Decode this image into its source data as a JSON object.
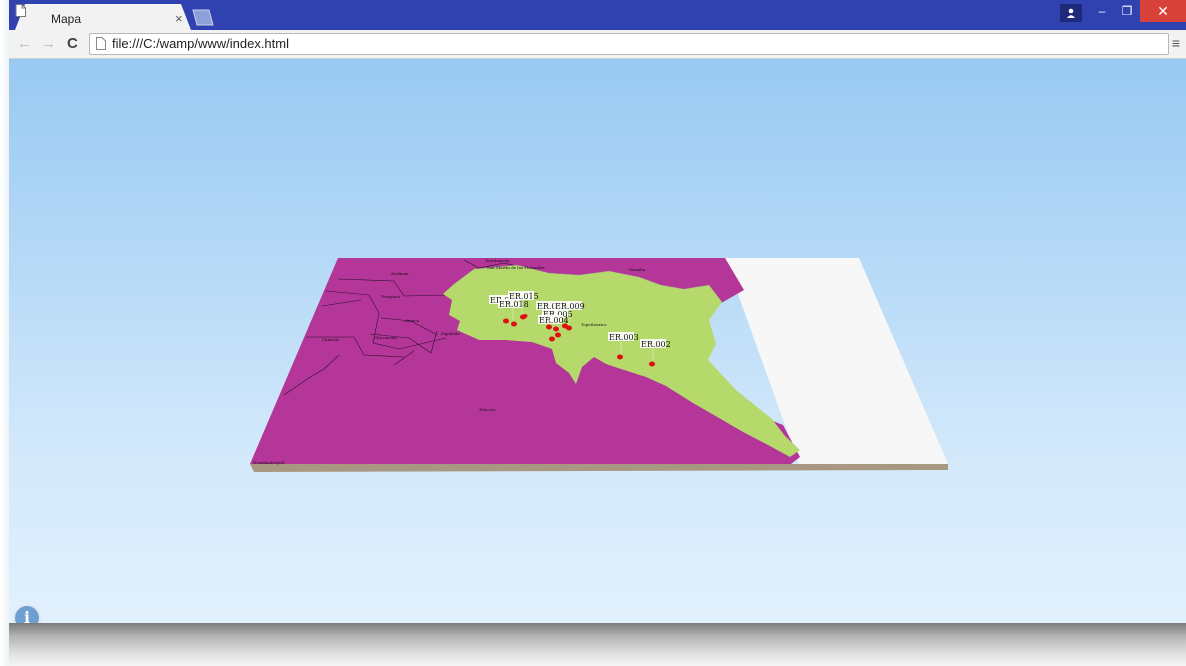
{
  "browser": {
    "tab_title": "Mapa",
    "tab_close": "×",
    "url": "file:///C:/wamp/www/index.html",
    "back_icon": "arrow-left-icon",
    "forward_icon": "arrow-right-icon",
    "reload_icon": "reload-icon",
    "menu_icon": "hamburger-menu-icon",
    "accent_color": "#3042b0",
    "close_color": "#d9423a"
  },
  "window_controls": {
    "user": "user-icon",
    "minimize": "–",
    "maximize": "❐",
    "close": "✕"
  },
  "map": {
    "region_colors": {
      "municipalities": "#b43699",
      "highlight": "#b6d96b",
      "outside": "#f7f7f7",
      "base_edge": "#a89882"
    },
    "place_labels": {
      "top_left": "Acolman",
      "top_center": "San Martín de las Pirámides",
      "top_right": "Otumba",
      "left_1": "Tezoyuca",
      "left_2": "Atenco",
      "left_3": "Chiconcuac",
      "left_4": "Chiautla",
      "left_5": "Papalotla",
      "center": "Tepetlaoxtoc",
      "south": "Texcoco",
      "corner": "Nezahualcóyotl",
      "top_tiny": "Teotihuacán"
    },
    "markers": [
      "ER.010",
      "ER.015",
      "ER.018",
      "ER.011",
      "ER.009",
      "ER.005",
      "ER.004",
      "ER.003",
      "ER.002"
    ],
    "marker_color": "#e01010"
  },
  "info_button": "i"
}
